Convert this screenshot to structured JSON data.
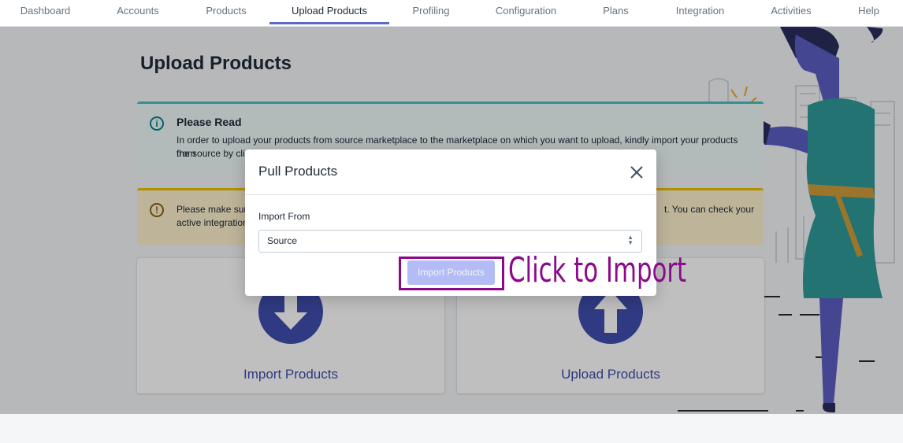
{
  "nav": {
    "items": [
      "Dashboard",
      "Accounts",
      "Products",
      "Upload Products",
      "Profiling",
      "Configuration",
      "Plans",
      "Integration",
      "Activities",
      "Help"
    ],
    "active": "Upload Products"
  },
  "page": {
    "title": "Upload Products",
    "info_banner": {
      "title": "Please Read",
      "text_line1": "In order to upload your products from source marketplace to the marketplace on which you want to upload, kindly import your products from",
      "text_line2": "the source by clicking on \"Import Products\" and then upload your products by clicking on \"Upload Products\"."
    },
    "warning_banner": {
      "text_left": "Please make sur",
      "text_right": "t. You can check your",
      "text_line2": "active integration"
    },
    "cards": [
      {
        "label": "Import Products",
        "icon": "arrow-down-icon"
      },
      {
        "label": "Upload Products",
        "icon": "arrow-up-icon"
      }
    ]
  },
  "modal": {
    "title": "Pull Products",
    "field_label": "Import From",
    "select_value": "Source",
    "button_label": "Import Products"
  },
  "callout": {
    "text": "Click to Import",
    "color": "#8b0a8b"
  },
  "colors": {
    "accent": "#5c6ac4",
    "card_icon": "#3f4eae",
    "info_border": "#47c1bf",
    "warn_border": "#eec200"
  }
}
